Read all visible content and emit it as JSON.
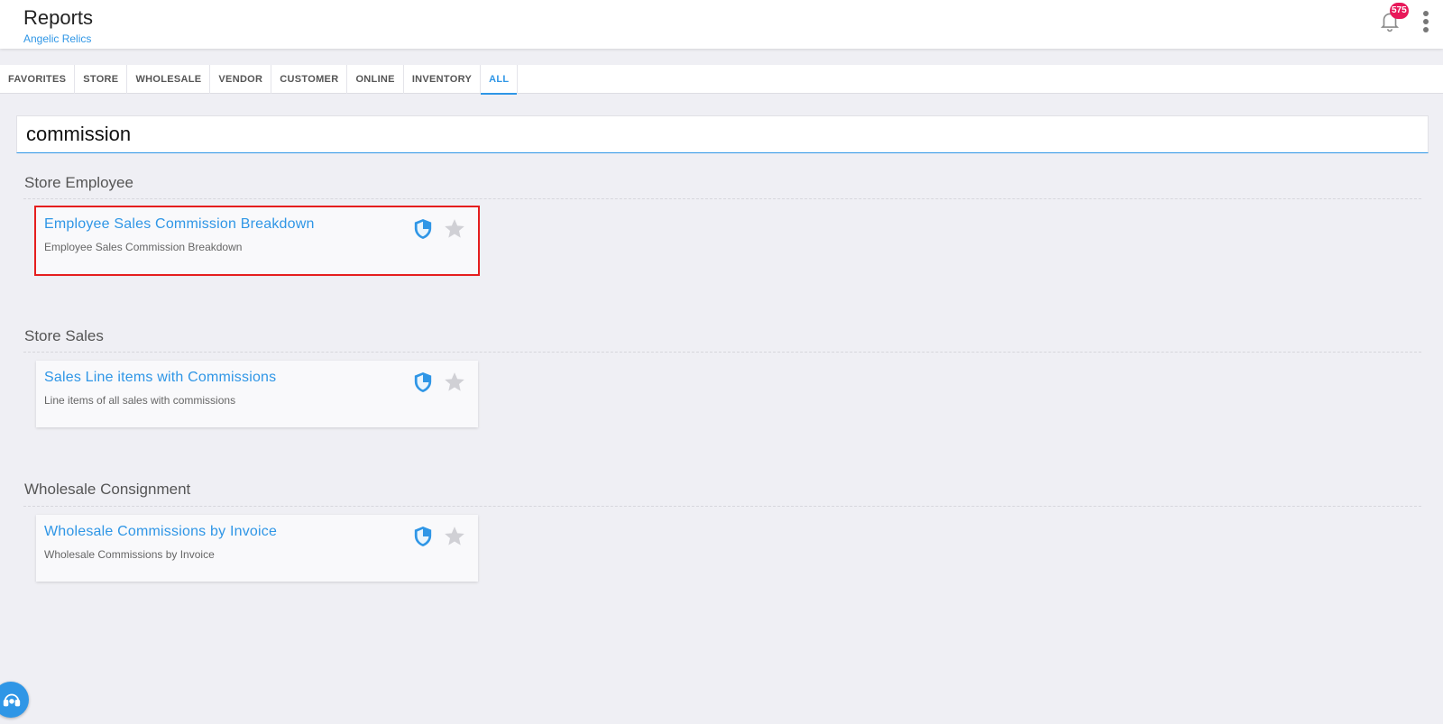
{
  "header": {
    "title": "Reports",
    "subtitle": "Angelic Relics",
    "notification_count": "575",
    "bell_icon": "bell-icon",
    "menu_icon": "more-vertical-icon"
  },
  "tabs": [
    {
      "label": "FAVORITES",
      "active": false
    },
    {
      "label": "STORE",
      "active": false
    },
    {
      "label": "WHOLESALE",
      "active": false
    },
    {
      "label": "VENDOR",
      "active": false
    },
    {
      "label": "CUSTOMER",
      "active": false
    },
    {
      "label": "ONLINE",
      "active": false
    },
    {
      "label": "INVENTORY",
      "active": false
    },
    {
      "label": "ALL",
      "active": true
    }
  ],
  "search": {
    "value": "commission"
  },
  "sections": [
    {
      "title": "Store Employee",
      "reports": [
        {
          "title": "Employee Sales Commission Breakdown",
          "description": "Employee Sales Commission Breakdown",
          "highlighted": true
        }
      ]
    },
    {
      "title": "Store Sales",
      "reports": [
        {
          "title": "Sales Line items with Commissions",
          "description": "Line items of all sales with commissions",
          "highlighted": false
        }
      ]
    },
    {
      "title": "Wholesale Consignment",
      "reports": [
        {
          "title": "Wholesale Commissions by Invoice",
          "description": "Wholesale Commissions by Invoice",
          "highlighted": false
        }
      ]
    }
  ],
  "colors": {
    "accent": "#2f96e6",
    "badge": "#e8185a",
    "highlight_border": "#e51e1e",
    "star_inactive": "#d0d0d5"
  },
  "icons": {
    "card_shield": "shield-icon",
    "card_star": "star-icon",
    "help": "help-fab-icon"
  }
}
